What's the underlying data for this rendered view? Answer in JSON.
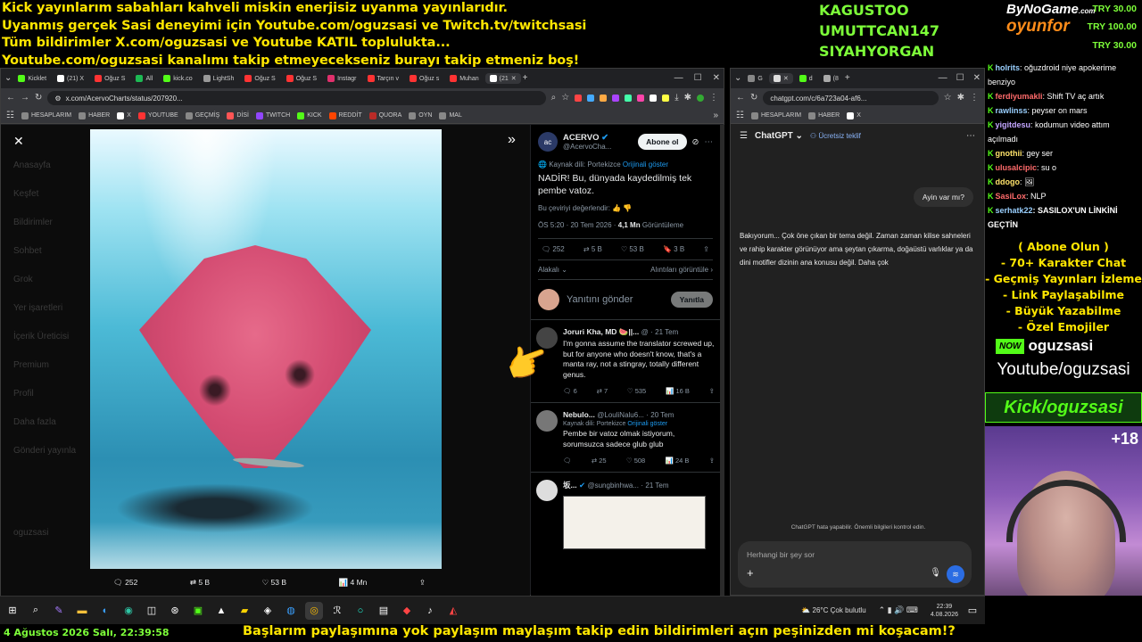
{
  "overlay": {
    "top_lines": [
      "Kick yayınlarım sabahları kahveli miskin enerjisiz uyanma yayınlarıdır.",
      "Uyanmış gerçek Sasi deneyimi için Youtube.com/oguzsasi ve Twitch.tv/twitchsasi",
      "Tüm bildirimler X.com/oguzsasi ve Youtube KATIL toplulukta...",
      "Youtube.com/oguzsasi kanalımı takip etmeyecekseniz burayı takip etmeniz boş!"
    ],
    "names": [
      "KAGUSTOO",
      "UMUTTCAN147",
      "SIYAHYORGAN"
    ],
    "logo_top": "ByNoGame",
    "logo_com": ".com",
    "logo_bottom": "oyunfor",
    "try_values": [
      "TRY 30.00",
      "TRY 100.00",
      "TRY 30.00"
    ],
    "date_line": "4 Ağustos 2026 Salı, 22:39:58",
    "ticker": "Başlarım paylaşımına yok paylaşım maylaşım takip edin bildirimleri açın peşinizden mi koşacam!?",
    "promo_lines": [
      "( Abone Olun )",
      "- 70+ Karakter Chat",
      "- Geçmiş Yayınları İzleme",
      "- Link Paylaşabilme",
      "- Büyük Yazabilme",
      "- Özel Emojiler"
    ],
    "kick_badge": "NOW",
    "kick_user": "oguzsasi",
    "youtube_text": "Youtube/oguzsasi",
    "kick_text": "Kick/oguzsasi",
    "plus_count": "+18"
  },
  "chat": [
    {
      "user": "holrits",
      "color": "#9ad0ff",
      "text": ": oğuzdroid niye apokerime benziyo"
    },
    {
      "user": "ferdiyumakli",
      "color": "#ff6b6b",
      "text": ": Shift TV aç artık"
    },
    {
      "user": "rawlinss",
      "color": "#9ad0ff",
      "text": ": peyser on mars"
    },
    {
      "user": "yigitdesu",
      "color": "#c3a6ff",
      "text": ": kodumun video attım açılmadı"
    },
    {
      "user": "gnothii",
      "color": "#ffe36b",
      "text": ": gey ser"
    },
    {
      "user": "ulusalcipic",
      "color": "#ff6b6b",
      "text": ": su o"
    },
    {
      "user": "ddogo",
      "color": "#ffe36b",
      "text": ": "
    },
    {
      "user": "SasiLox",
      "color": "#ff6b6b",
      "text": ": NLP"
    },
    {
      "user": "serhatk22",
      "color": "#9ad0ff",
      "text": ": SASILOX'UN LİNKİNİ GEÇTİN"
    }
  ],
  "left_browser": {
    "tabs": [
      "Kicklet",
      "(21) X",
      "Oğuz S",
      "All",
      "kick.co",
      "LightSh",
      "Oğuz S",
      "Oğuz S",
      "Instagr",
      "Tarçın v",
      "Oğuz s",
      "Muhan",
      "(21"
    ],
    "url": "x.com/AcervoCharts/status/207920...",
    "bookmarks": [
      "HESAPLARIM",
      "HABER",
      "X",
      "YOUTUBE",
      "GEÇMİŞ",
      "DİSİ",
      "TWITCH",
      "KICK",
      "REDDİT",
      "QUORA",
      "OYN",
      "MAL"
    ]
  },
  "x_sidebar": [
    "Anasayfa",
    "Keşfet",
    "Bildirimler",
    "Sohbet",
    "Grok",
    "Yer işaretleri",
    "İçerik Üreticisi",
    "Premium",
    "Profil",
    "Daha fazla",
    "Gönderi yayınla"
  ],
  "x_sidebar_user": "oguzsasi",
  "media_stats": {
    "replies": "252",
    "reposts": "5 B",
    "likes": "53 B",
    "views": "4 Mn"
  },
  "tweet": {
    "author": "ACERVO",
    "handle": "@AcervoCha...",
    "follow": "Abone ol",
    "source_lang": "Kaynak dili: Portekizce",
    "show_original": "Orijinali göster",
    "text": "NADİR! Bu, dünyada kaydedilmiş tek pembe vatoz.",
    "rate": "Bu çeviriyi değerlendir:",
    "time": "ÖS 5:20 · 20 Tem 2026 ·",
    "views": "4,1 Mn",
    "views_label": "Görüntüleme",
    "replies": "252",
    "reposts": "5 B",
    "likes": "53 B",
    "bookmarks": "3 B",
    "sort": "Alakalı",
    "quoted": "Alıntıları görüntüle",
    "reply_placeholder": "Yanıtını gönder",
    "reply_button": "Yanıtla"
  },
  "replies": [
    {
      "name": "Joruri Kha, MD 🍉||...",
      "handle": "@",
      "date": "21 Tem",
      "text": "I'm gonna assume the translator screwed up, but for anyone who doesn't know, that's a manta ray, not a stingray, totally different genus.",
      "r": "6",
      "rt": "7",
      "l": "535",
      "v": "16 B"
    },
    {
      "name": "Nebulo...",
      "handle": "@LouliNalu6...",
      "date": "20 Tem",
      "lang": "Kaynak dili: Portekizce",
      "orig": "Orijinali göster",
      "text": "Pembe bir vatoz olmak istiyorum, sorumsuzca sadece glub glub",
      "r": "",
      "rt": "25",
      "l": "508",
      "v": "24 B"
    },
    {
      "name": "坂...",
      "handle": "@sungbinhwa...",
      "date": "21 Tem",
      "text": ""
    }
  ],
  "right_browser": {
    "url": "chatgpt.com/c/6a723a04-af6...",
    "bookmarks": [
      "HESAPLARIM",
      "HABER",
      "X"
    ],
    "model": "ChatGPT",
    "free": "Ücretsiz teklif",
    "user_msg": "Ayin var mı?",
    "answer": "Bakıyorum... Çok öne çıkan bir tema değil. Zaman zaman kilise sahneleri ve rahip karakter görünüyor ama şeytan çıkarma, doğaüstü varlıklar ya da dini motifler dizinin ana konusu değil. Daha çok",
    "disclaimer": "ChatGPT hata yapabilir. Önemli bilgileri kontrol edin.",
    "input_placeholder": "Herhangi bir şey sor"
  },
  "taskbar": {
    "weather": "26°C  Çok bulutlu",
    "time": "22:39",
    "date": "4.08.2026"
  }
}
